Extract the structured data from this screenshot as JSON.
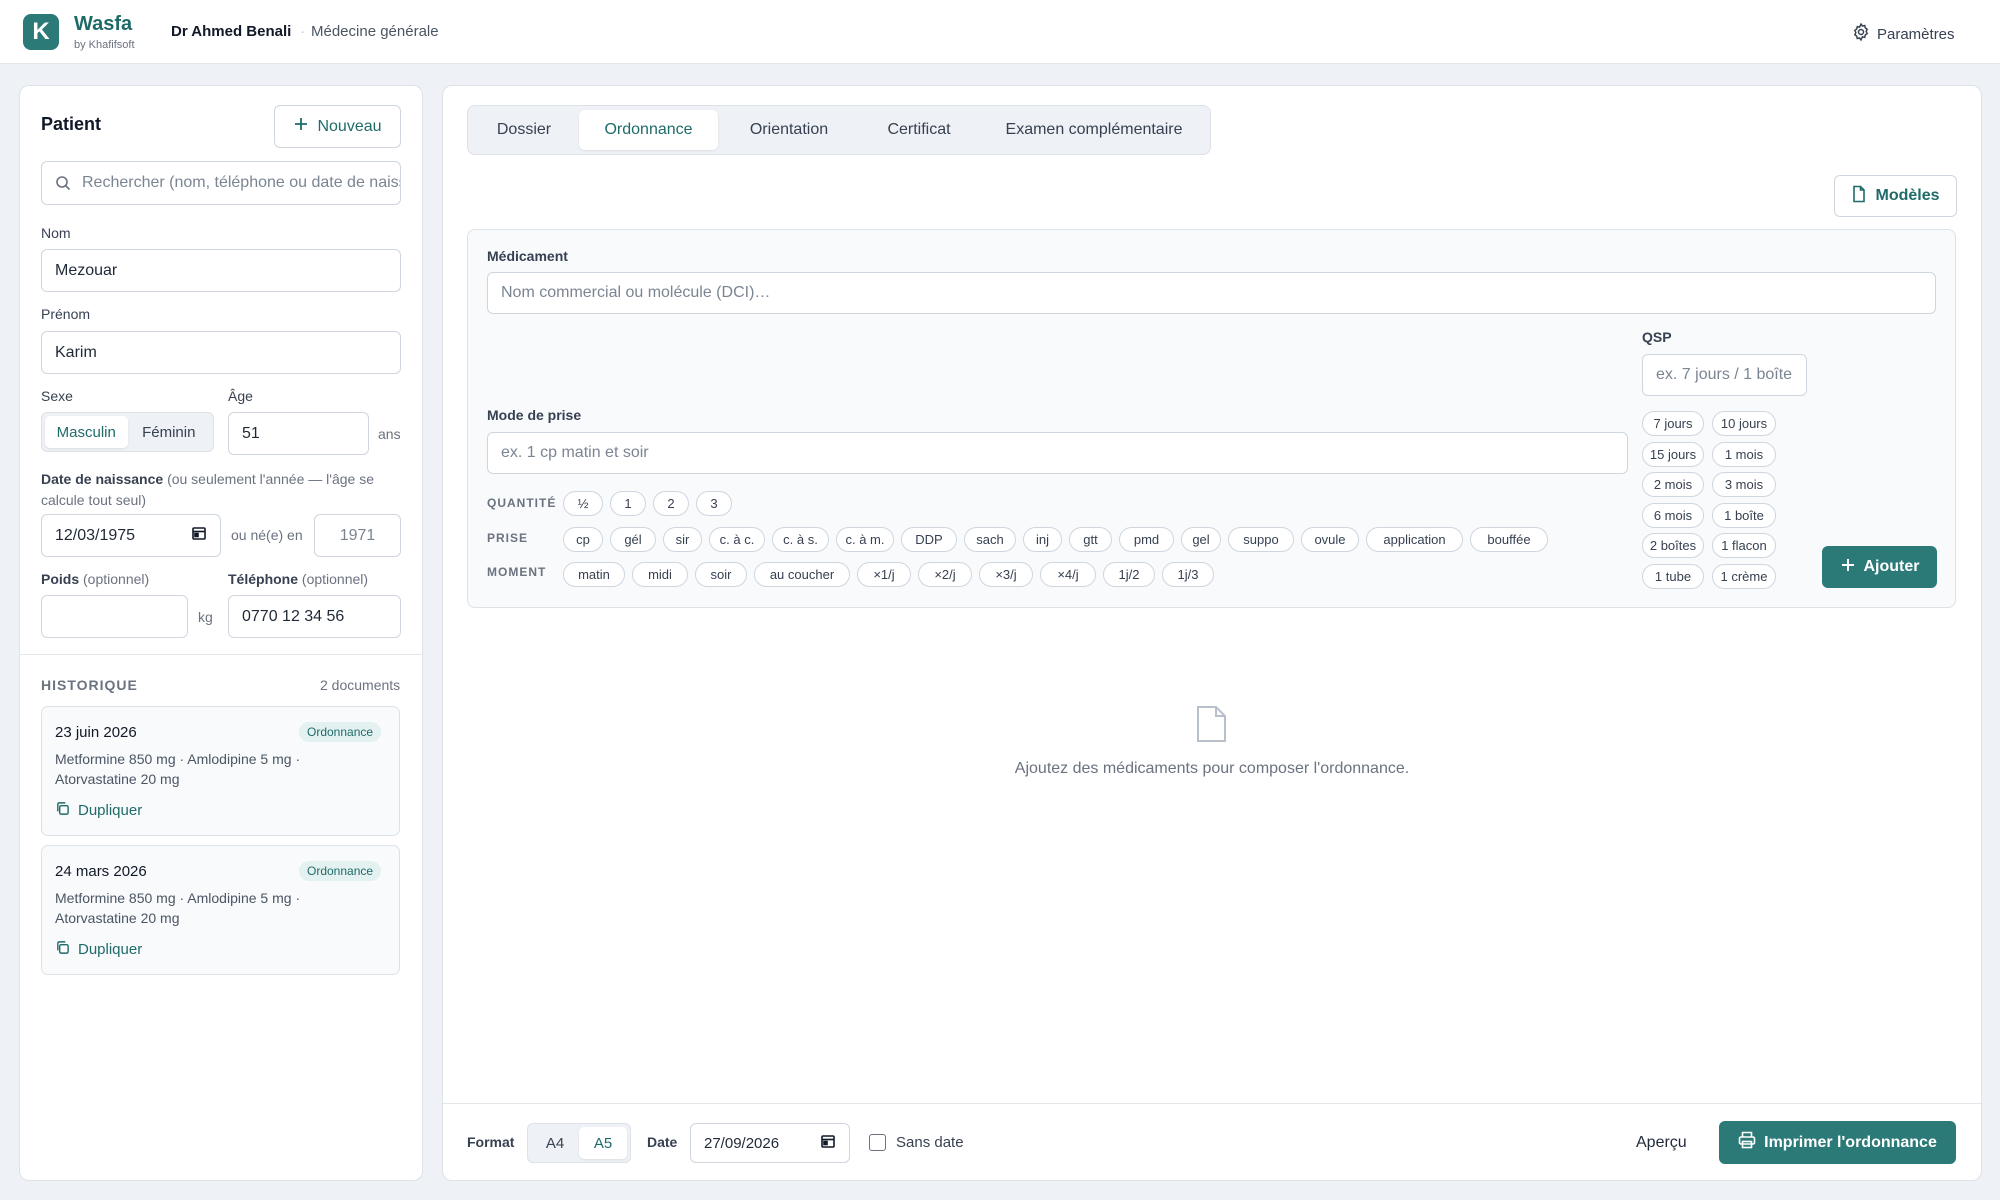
{
  "header": {
    "brand": "Wasfa",
    "brand_sub": "by Khafifsoft",
    "logo_letter": "K",
    "doctor": "Dr Ahmed Benali",
    "specialty": "Médecine générale",
    "settings_label": "Paramètres"
  },
  "patient": {
    "title": "Patient",
    "new_label": "Nouveau",
    "search_placeholder": "Rechercher (nom, téléphone ou date de naissance)",
    "nom_label": "Nom",
    "nom_value": "Mezouar",
    "prenom_label": "Prénom",
    "prenom_value": "Karim",
    "sexe_label": "Sexe",
    "sexe_options": [
      "Masculin",
      "Féminin"
    ],
    "sexe_selected": "Masculin",
    "age_label": "Âge",
    "age_value": "51",
    "age_unit": "ans",
    "dob_label": "Date de naissance",
    "dob_hint": "(ou seulement l'année — l'âge se calcule tout seul)",
    "dob_value": "12/03/1975",
    "born_in_label": "ou né(e) en",
    "born_in_placeholder": "1971",
    "poids_label": "Poids",
    "poids_opt": "(optionnel)",
    "poids_unit": "kg",
    "tel_label": "Téléphone",
    "tel_opt": "(optionnel)",
    "tel_value": "0770 12 34 56"
  },
  "history": {
    "title": "HISTORIQUE",
    "count": "2 documents",
    "items": [
      {
        "date": "23 juin 2026",
        "badge": "Ordonnance",
        "line1": "Metformine 850 mg · Amlodipine 5 mg ·",
        "line2": "Atorvastatine 20 mg",
        "action": "Dupliquer"
      },
      {
        "date": "24 mars 2026",
        "badge": "Ordonnance",
        "line1": "Metformine 850 mg · Amlodipine 5 mg ·",
        "line2": "Atorvastatine 20 mg",
        "action": "Dupliquer"
      }
    ]
  },
  "tabs": [
    "Dossier",
    "Ordonnance",
    "Orientation",
    "Certificat",
    "Examen complémentaire"
  ],
  "active_tab": "Ordonnance",
  "modeles_label": "Modèles",
  "rx": {
    "med_label": "Médicament",
    "med_placeholder": "Nom commercial ou molécule (DCI)…",
    "mode_label": "Mode de prise",
    "mode_placeholder": "ex. 1 cp matin et soir",
    "qsp_label": "QSP",
    "qsp_placeholder": "ex. 7 jours / 1 boîte",
    "quantite_label": "QUANTITÉ",
    "quantite": [
      "½",
      "1",
      "2",
      "3"
    ],
    "prise_label": "PRISE",
    "prise": [
      "cp",
      "gél",
      "sir",
      "c. à c.",
      "c. à s.",
      "c. à m.",
      "DDP",
      "sach",
      "inj",
      "gtt",
      "pmd",
      "gel",
      "suppo",
      "ovule",
      "application",
      "bouffée"
    ],
    "moment_label": "MOMENT",
    "moment": [
      "matin",
      "midi",
      "soir",
      "au coucher",
      "×1/j",
      "×2/j",
      "×3/j",
      "×4/j",
      "1j/2",
      "1j/3"
    ],
    "qsp_chips": [
      "7 jours",
      "10 jours",
      "15 jours",
      "1 mois",
      "2 mois",
      "3 mois",
      "6 mois",
      "1 boîte",
      "2 boîtes",
      "1 flacon",
      "1 tube",
      "1 crème"
    ],
    "add_label": "Ajouter"
  },
  "empty_text": "Ajoutez des médicaments pour composer l'ordonnance.",
  "footer": {
    "format_label": "Format",
    "formats": [
      "A4",
      "A5"
    ],
    "format_selected": "A5",
    "date_label": "Date",
    "date_value": "27/09/2026",
    "sans_date_label": "Sans date",
    "apercu_label": "Aperçu",
    "print_label": "Imprimer l'ordonnance"
  },
  "colors": {
    "accent": "#2b7a78",
    "accent_text": "#1f6b69",
    "background": "#eef1f5"
  }
}
